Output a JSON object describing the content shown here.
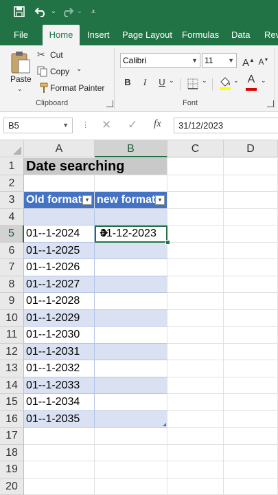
{
  "qat": {
    "save_icon": "save-icon",
    "undo_icon": "undo-icon",
    "redo_icon": "redo-icon",
    "customize_icon": "customize-icon"
  },
  "tabs": [
    {
      "label": "File"
    },
    {
      "label": "Home",
      "active": true
    },
    {
      "label": "Insert"
    },
    {
      "label": "Page Layout"
    },
    {
      "label": "Formulas"
    },
    {
      "label": "Data"
    },
    {
      "label": "Rev"
    }
  ],
  "clipboard": {
    "paste_label": "Paste",
    "cut_label": "Cut",
    "copy_label": "Copy",
    "format_painter_label": "Format Painter",
    "group_label": "Clipboard"
  },
  "font": {
    "name": "Calibri",
    "size": "11",
    "bold": "B",
    "italic": "I",
    "underline": "U",
    "font_color_letter": "A",
    "group_label": "Font"
  },
  "formula_bar": {
    "name_box": "B5",
    "fx_symbol": "fx",
    "content": "31/12/2023"
  },
  "colors": {
    "ribbon_green": "#217346",
    "table_header": "#4472c4",
    "band": "#d9e1f2"
  },
  "columns": [
    "A",
    "B",
    "C",
    "D"
  ],
  "rows": [
    "1",
    "2",
    "3",
    "4",
    "5",
    "6",
    "7",
    "8",
    "9",
    "10",
    "11",
    "12",
    "13",
    "14",
    "15",
    "16",
    "17",
    "18",
    "19",
    "20"
  ],
  "sheet": {
    "title": "Date searching",
    "table_headers": [
      "Old format",
      "new format"
    ],
    "old_format": [
      "01--1-2024",
      "01--1-2025",
      "01--1-2026",
      "01--1-2027",
      "01--1-2028",
      "01--1-2029",
      "01--1-2030",
      "01--1-2031",
      "01--1-2032",
      "01--1-2033",
      "01--1-2034",
      "01--1-2035"
    ],
    "b5_value": "31-12-2023"
  }
}
